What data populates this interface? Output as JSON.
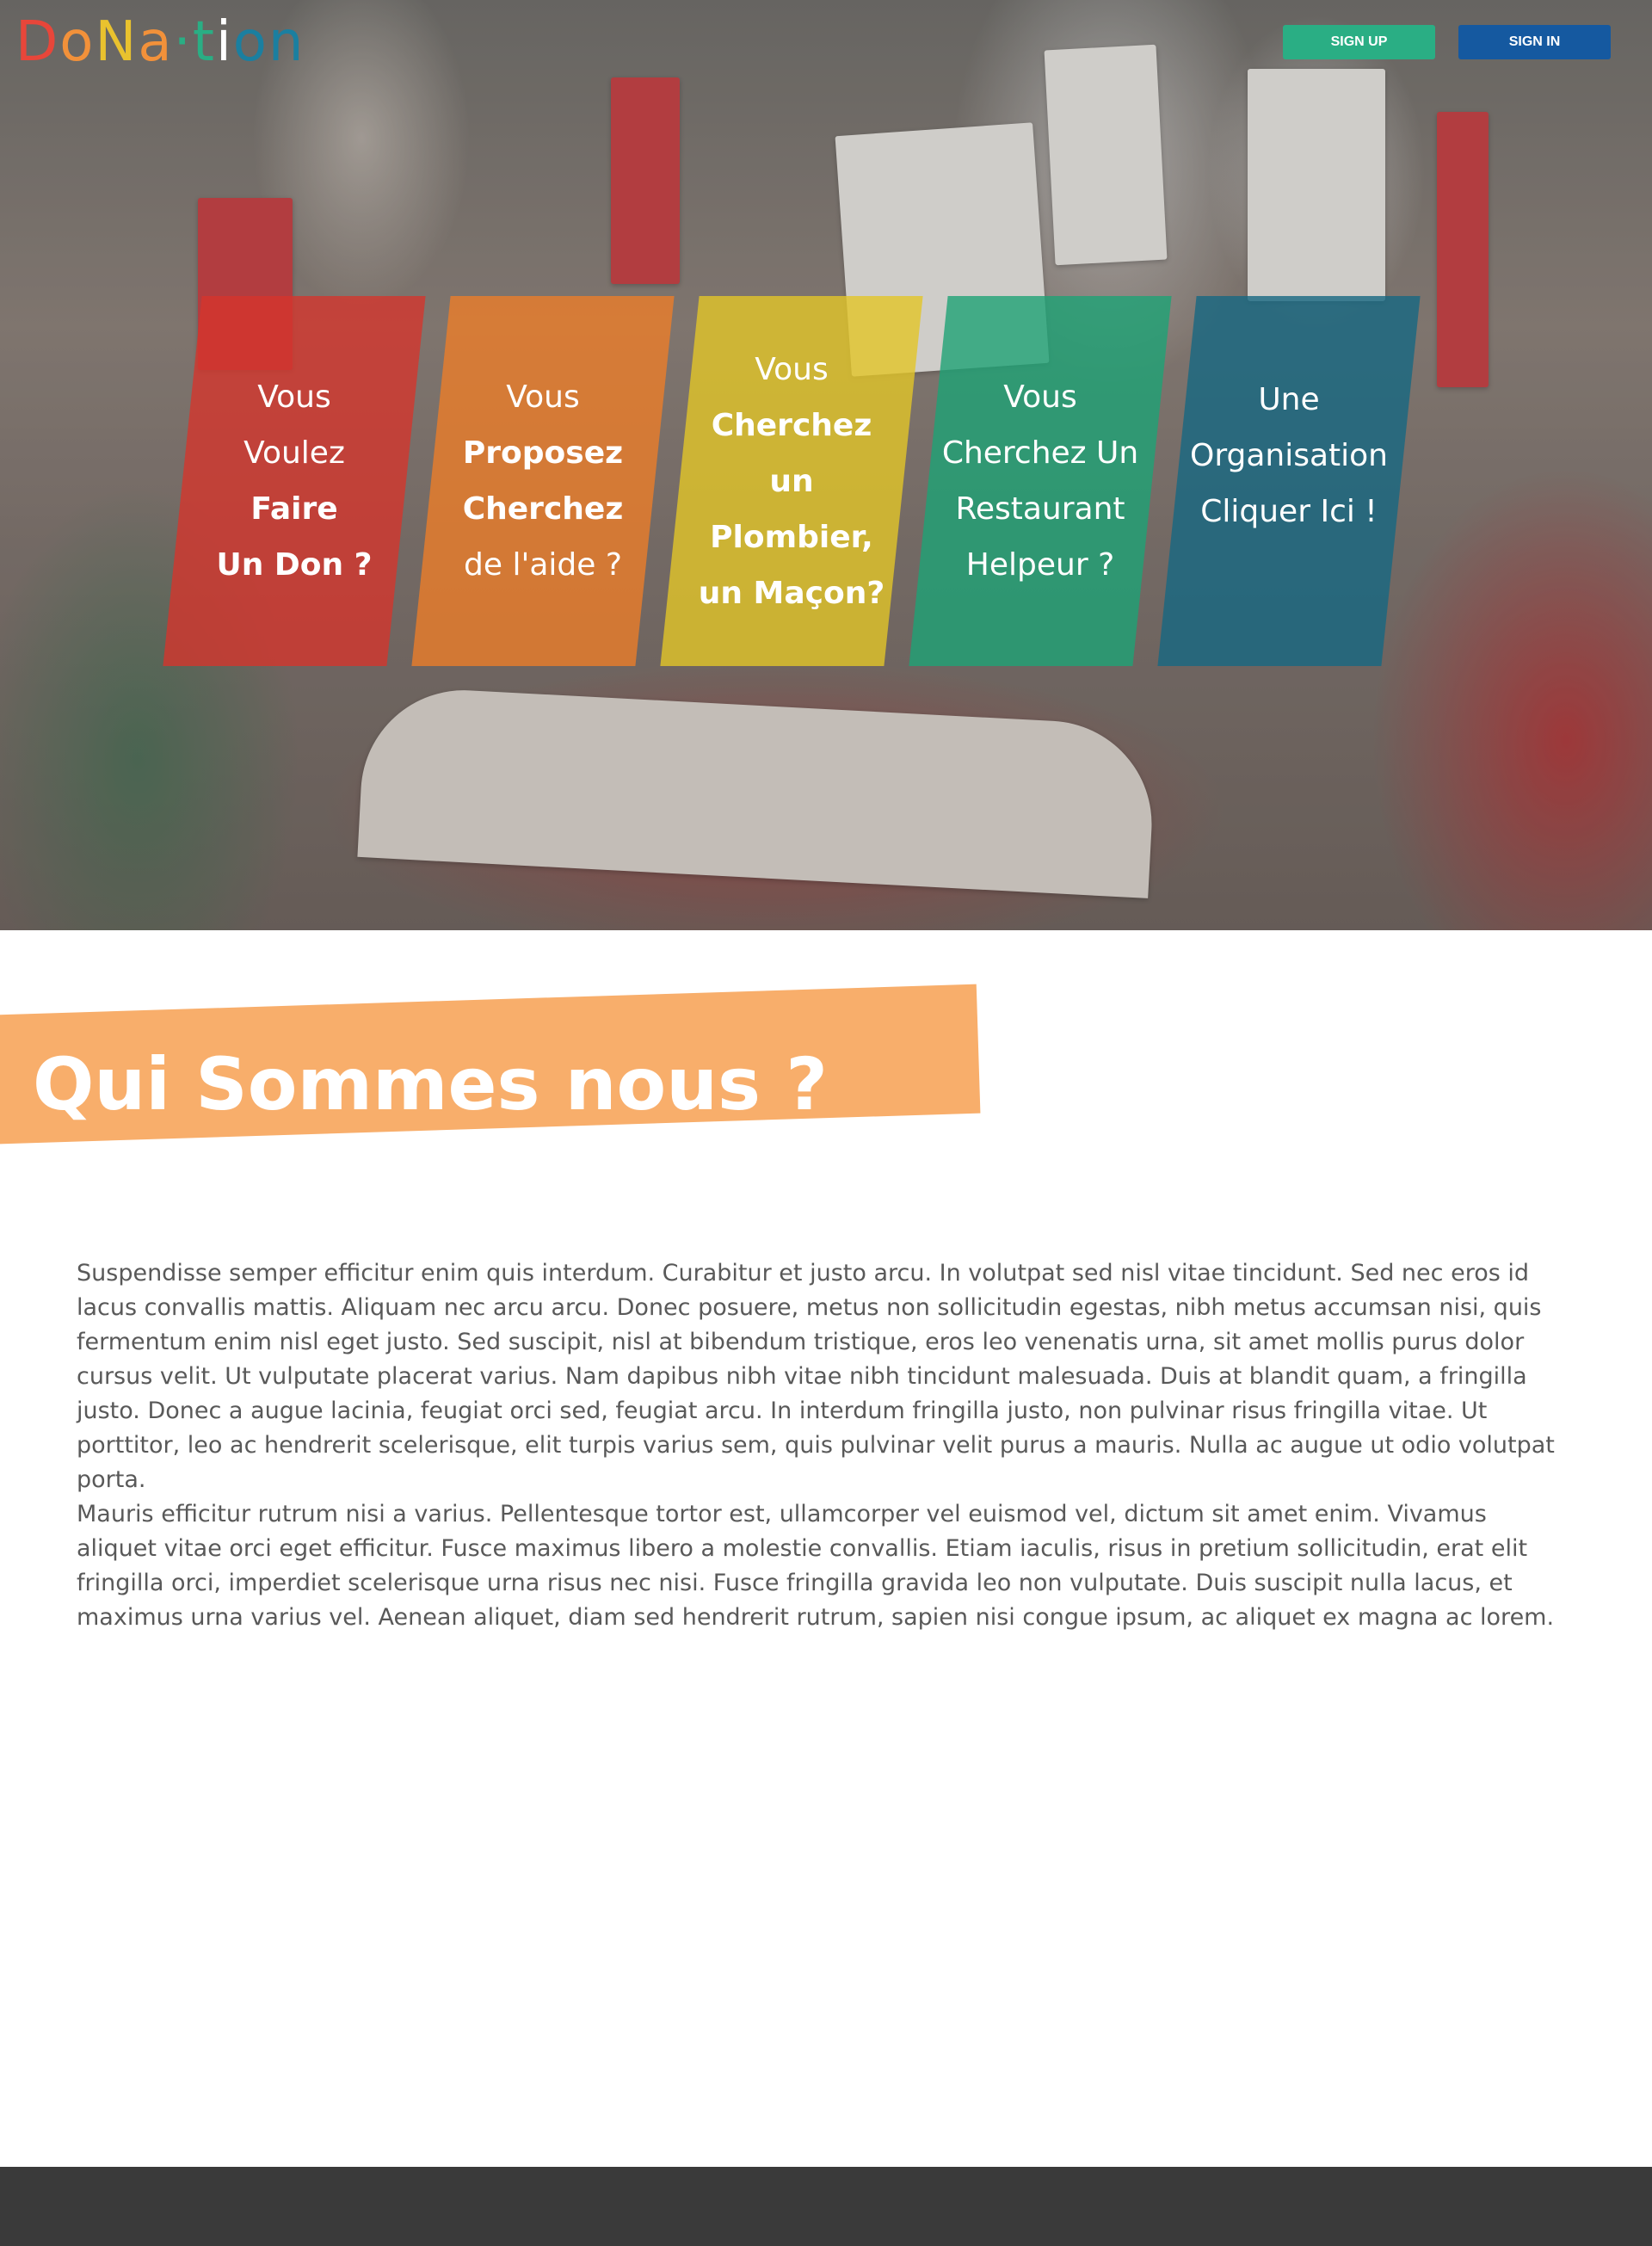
{
  "header": {
    "logo": {
      "letters": [
        {
          "char": "D",
          "color": "#e8463a"
        },
        {
          "char": "o",
          "color": "#f2913a"
        },
        {
          "char": "N",
          "color": "#e9c22e"
        },
        {
          "char": "a",
          "color": "#f2913a"
        },
        {
          "char": "·",
          "color": "#2aae84"
        },
        {
          "char": "t",
          "color": "#2aae84"
        },
        {
          "char": "i",
          "color": "#ffffff"
        },
        {
          "char": "o",
          "color": "#1b7fa0"
        },
        {
          "char": "n",
          "color": "#1b7fa0"
        }
      ]
    },
    "signup_label": "SIGN UP",
    "signin_label": "SIGN IN",
    "colors": {
      "signup": "#2aae84",
      "signin": "#1559a0"
    }
  },
  "hero": {
    "cards": [
      {
        "lines": [
          "Vous",
          "Voulez",
          "Faire",
          "Un Don ?"
        ],
        "color": "#d6342c"
      },
      {
        "lines": [
          "Vous",
          "Proposez",
          "Cherchez",
          "de l'aide ?"
        ],
        "color": "#ee7e28"
      },
      {
        "lines": [
          "Vous",
          "Cherchez un",
          "Plombier,",
          "un Maçon?"
        ],
        "color": "#e2c628"
      },
      {
        "lines": [
          "Vous",
          "Cherchez Un",
          "Restaurant",
          "Helpeur ?"
        ],
        "color": "#1ea276"
      },
      {
        "lines": [
          "Une",
          "Organisation",
          "Cliquer Ici !"
        ],
        "color": "#166882"
      }
    ]
  },
  "about": {
    "title": "Qui Sommes nous ?",
    "banner_color": "#f8ae6b",
    "paragraphs": [
      "Suspendisse semper efficitur enim quis interdum. Curabitur et justo arcu. In volutpat sed nisl vitae tincidunt. Sed nec eros id lacus convallis mattis. Aliquam nec arcu arcu. Donec posuere, metus non sollicitudin egestas, nibh metus accumsan nisi, quis fermentum enim nisl eget justo. Sed suscipit, nisl at bibendum tristique, eros leo venenatis urna, sit amet mollis purus dolor cursus velit. Ut vulputate placerat varius. Nam dapibus nibh vitae nibh tincidunt malesuada. Duis at blandit quam, a fringilla justo. Donec a augue lacinia, feugiat orci sed, feugiat arcu. In interdum fringilla justo, non pulvinar risus fringilla vitae. Ut porttitor, leo ac hendrerit scelerisque, elit turpis varius sem, quis pulvinar velit purus a mauris. Nulla ac augue ut odio volutpat porta.",
      "Mauris efficitur rutrum nisi a varius. Pellentesque tortor est, ullamcorper vel euismod vel, dictum sit amet enim. Vivamus aliquet vitae orci eget efficitur. Fusce maximus libero a molestie convallis. Etiam iaculis, risus in pretium sollicitudin, erat elit fringilla orci, imperdiet scelerisque urna risus nec nisi. Fusce fringilla gravida leo non vulputate. Duis suscipit nulla lacus, et maximus urna varius vel. Aenean aliquet, diam sed hendrerit rutrum, sapien nisi congue ipsum, ac aliquet ex magna ac lorem."
    ]
  }
}
